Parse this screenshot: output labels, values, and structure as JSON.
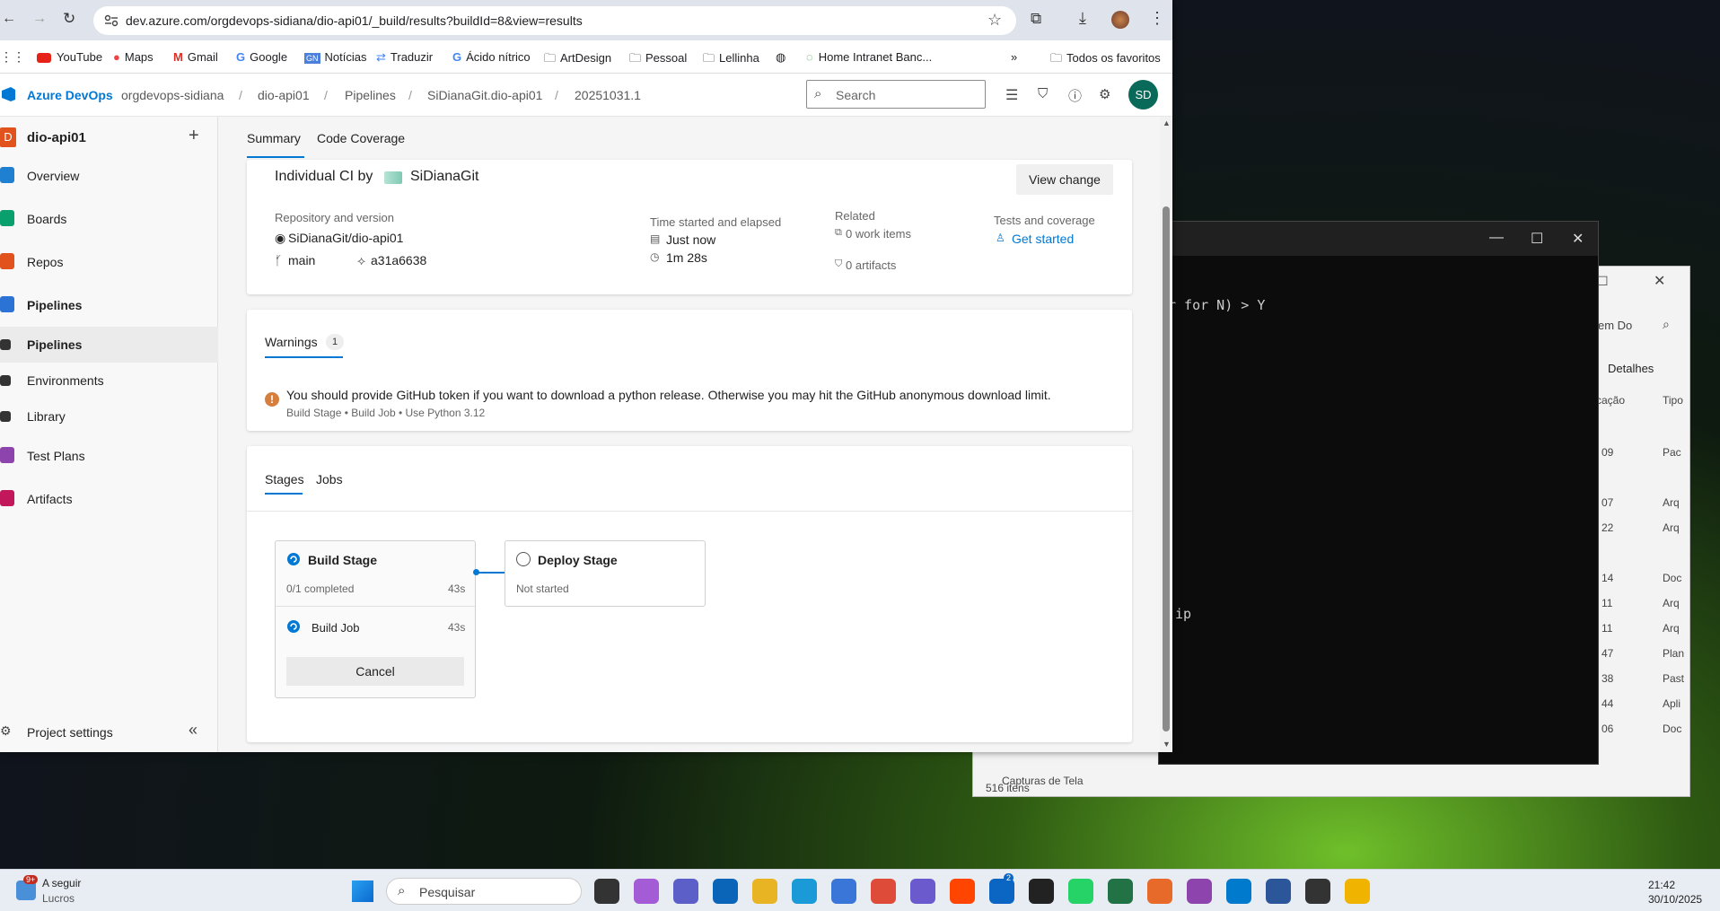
{
  "browser": {
    "url": "dev.azure.com/orgdevops-sidiana/dio-api01/_build/results?buildId=8&view=results",
    "bookmarks": [
      "YouTube",
      "Maps",
      "Gmail",
      "Google",
      "Notícias",
      "Traduzir",
      "Ácido nítrico",
      "ArtDesign",
      "Pessoal",
      "Lellinha",
      "Home Intranet Banc...",
      "Todos os favoritos"
    ]
  },
  "header": {
    "brand": "Azure DevOps",
    "breadcrumbs": [
      "orgdevops-sidiana",
      "dio-api01",
      "Pipelines",
      "SiDianaGit.dio-api01",
      "20251031.1"
    ],
    "search_placeholder": "Search",
    "avatar_initials": "SD"
  },
  "sidebar": {
    "project_initial": "D",
    "project_name": "dio-api01",
    "add_label": "+",
    "items": [
      {
        "label": "Overview",
        "color": "#1f7fd1"
      },
      {
        "label": "Boards",
        "color": "#0aa06e"
      },
      {
        "label": "Repos",
        "color": "#e2521d"
      },
      {
        "label": "Pipelines",
        "color": "#2b73d4"
      },
      {
        "label": "Pipelines",
        "color": "#333333"
      },
      {
        "label": "Environments",
        "color": "#333333"
      },
      {
        "label": "Library",
        "color": "#333333"
      },
      {
        "label": "Test Plans",
        "color": "#8e44ad"
      },
      {
        "label": "Artifacts",
        "color": "#c2185b"
      }
    ],
    "settings_label": "Project settings",
    "collapse_label": "«"
  },
  "tabs": [
    "Summary",
    "Code Coverage"
  ],
  "summary": {
    "trigger_text": "Individual CI by",
    "trigger_user": "SiDianaGit",
    "view_change": "View change",
    "repo_label": "Repository and version",
    "repo_name": "SiDianaGit/dio-api01",
    "branch": "main",
    "commit": "a31a6638",
    "time_label": "Time started and elapsed",
    "started": "Just now",
    "elapsed": "1m 28s",
    "related_label": "Related",
    "work_items": "0 work items",
    "artifacts": "0 artifacts",
    "tests_label": "Tests and coverage",
    "get_started": "Get started"
  },
  "warnings": {
    "title": "Warnings",
    "count": "1",
    "message": "You should provide GitHub token if you want to download a python release. Otherwise you may hit the GitHub anonymous download limit.",
    "source": "Build Stage • Build Job • Use Python 3.12"
  },
  "stages": {
    "tabs": [
      "Stages",
      "Jobs"
    ],
    "build": {
      "name": "Build Stage",
      "progress": "0/1 completed",
      "duration": "43s",
      "job": "Build Job",
      "job_duration": "43s",
      "cancel": "Cancel"
    },
    "deploy": {
      "name": "Deploy Stage",
      "status": "Not started"
    }
  },
  "console": {
    "line1": "r for N) > Y",
    "line2": "ip"
  },
  "explorer": {
    "search": "em Do",
    "details": "Detalhes",
    "col_loc": "cação",
    "col_type": "Tipo",
    "folder": "Capturas de Tela",
    "count": "516 itens",
    "rows": [
      [
        "09",
        "Pac"
      ],
      [
        "07",
        "Arq"
      ],
      [
        "22",
        "Arq"
      ],
      [
        "14",
        "Doc"
      ],
      [
        "11",
        "Arq"
      ],
      [
        "11",
        "Arq"
      ],
      [
        "47",
        "Plan"
      ],
      [
        "38",
        "Past"
      ],
      [
        "44",
        "Apli"
      ],
      [
        "06",
        "Doc"
      ]
    ]
  },
  "taskbar": {
    "weather_badge": "9+",
    "weather_title": "A seguir",
    "weather_sub": "Lucros",
    "search": "Pesquisar",
    "time": "21:42",
    "date": "30/10/2025",
    "teams_badge": "2"
  }
}
